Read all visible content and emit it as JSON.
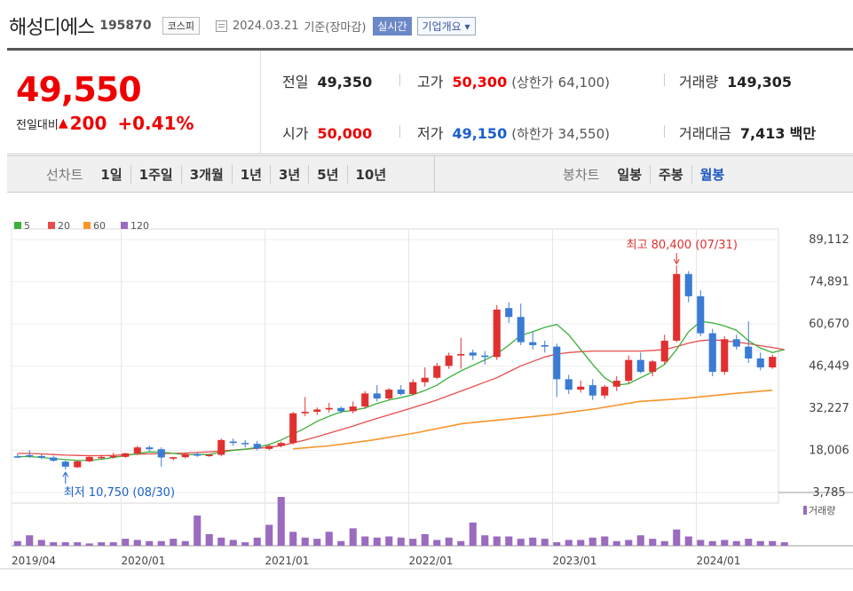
{
  "header": {
    "name": "해성디에스",
    "code": "195870",
    "market": "코스피",
    "date": "2024.03.21",
    "basis": "기준(장마감)",
    "realtime": "실시간",
    "overview": "기업개요"
  },
  "quote": {
    "price": "49,550",
    "diff_label": "전일대비",
    "diff_tri": "▲",
    "diff": "200",
    "rate": "+0.41%",
    "prev_label": "전일",
    "prev": "49,350",
    "high_label": "고가",
    "high": "50,300",
    "upper_label": "(상한가",
    "upper": "64,100)",
    "volume_label": "거래량",
    "volume": "149,305",
    "open_label": "시가",
    "open": "50,000",
    "low_label": "저가",
    "low": "49,150",
    "lower_label": "(하한가",
    "lower": "34,550)",
    "amount_label": "거래대금",
    "amount": "7,413",
    "amount_unit": "백만"
  },
  "tabs": {
    "line_label": "선차트",
    "line_periods": [
      "1일",
      "1주일",
      "3개월",
      "1년",
      "3년",
      "5년",
      "10년"
    ],
    "candle_label": "봉차트",
    "candle_periods": [
      "일봉",
      "주봉",
      "월봉"
    ],
    "active_candle": 2
  },
  "chart_data": {
    "type": "candlestick",
    "legend": [
      {
        "name": "5",
        "color": "#3cb03c"
      },
      {
        "name": "20",
        "color": "#e84c4c"
      },
      {
        "name": "60",
        "color": "#f7952b"
      },
      {
        "name": "120",
        "color": "#9a6bbf"
      }
    ],
    "yticks": [
      "89,112",
      "74,891",
      "60,670",
      "46,449",
      "32,227",
      "18,006",
      "3,785"
    ],
    "ylim": [
      3785,
      89112
    ],
    "xticks": [
      "2019/04",
      "2020/01",
      "2021/01",
      "2022/01",
      "2023/01",
      "2024/01"
    ],
    "max_annotation": "최고 80,400 (07/31)",
    "min_annotation": "최저 10,750 (08/30)",
    "volume_label": "거래량",
    "up_color": "#e03030",
    "down_color": "#3a7bd5",
    "candles": [
      {
        "o": 16000,
        "h": 16800,
        "l": 15500,
        "c": 15900
      },
      {
        "o": 16400,
        "h": 18100,
        "l": 15400,
        "c": 16100
      },
      {
        "o": 16100,
        "h": 16700,
        "l": 15000,
        "c": 15600
      },
      {
        "o": 15600,
        "h": 16200,
        "l": 14200,
        "c": 14500
      },
      {
        "o": 14200,
        "h": 14600,
        "l": 11500,
        "c": 12500
      },
      {
        "o": 12300,
        "h": 14500,
        "l": 12000,
        "c": 14300
      },
      {
        "o": 14300,
        "h": 16000,
        "l": 14000,
        "c": 15800
      },
      {
        "o": 15800,
        "h": 16500,
        "l": 15000,
        "c": 15800
      },
      {
        "o": 15800,
        "h": 17200,
        "l": 15200,
        "c": 16100
      },
      {
        "o": 15800,
        "h": 17200,
        "l": 15500,
        "c": 17000
      },
      {
        "o": 17000,
        "h": 19500,
        "l": 16500,
        "c": 19000
      },
      {
        "o": 19000,
        "h": 19700,
        "l": 17800,
        "c": 18400
      },
      {
        "o": 18400,
        "h": 19000,
        "l": 12500,
        "c": 15600
      },
      {
        "o": 15200,
        "h": 15800,
        "l": 14600,
        "c": 15700
      },
      {
        "o": 15700,
        "h": 17200,
        "l": 15300,
        "c": 16800
      },
      {
        "o": 16800,
        "h": 17300,
        "l": 15800,
        "c": 16200
      },
      {
        "o": 16200,
        "h": 16800,
        "l": 15800,
        "c": 16500
      },
      {
        "o": 16500,
        "h": 22000,
        "l": 16000,
        "c": 21500
      },
      {
        "o": 21000,
        "h": 22000,
        "l": 19500,
        "c": 20500
      },
      {
        "o": 20500,
        "h": 21500,
        "l": 19000,
        "c": 20200
      },
      {
        "o": 20200,
        "h": 21200,
        "l": 18000,
        "c": 18600
      },
      {
        "o": 18500,
        "h": 20000,
        "l": 18000,
        "c": 19500
      },
      {
        "o": 19500,
        "h": 21000,
        "l": 19000,
        "c": 20500
      },
      {
        "o": 20500,
        "h": 31000,
        "l": 20000,
        "c": 30500
      },
      {
        "o": 30500,
        "h": 36000,
        "l": 29500,
        "c": 31000
      },
      {
        "o": 31000,
        "h": 32500,
        "l": 30000,
        "c": 31800
      },
      {
        "o": 31800,
        "h": 34000,
        "l": 30800,
        "c": 32300
      },
      {
        "o": 32300,
        "h": 32800,
        "l": 30500,
        "c": 31200
      },
      {
        "o": 31200,
        "h": 34500,
        "l": 30500,
        "c": 32800
      },
      {
        "o": 32800,
        "h": 38000,
        "l": 32000,
        "c": 37200
      },
      {
        "o": 37200,
        "h": 40000,
        "l": 34500,
        "c": 35500
      },
      {
        "o": 35500,
        "h": 39000,
        "l": 35000,
        "c": 38500
      },
      {
        "o": 38500,
        "h": 40000,
        "l": 36500,
        "c": 37000
      },
      {
        "o": 37000,
        "h": 42000,
        "l": 36500,
        "c": 41000
      },
      {
        "o": 41000,
        "h": 46000,
        "l": 39500,
        "c": 42500
      },
      {
        "o": 42500,
        "h": 47500,
        "l": 42000,
        "c": 46500
      },
      {
        "o": 46500,
        "h": 51000,
        "l": 45500,
        "c": 50000
      },
      {
        "o": 50000,
        "h": 56000,
        "l": 45500,
        "c": 50500
      },
      {
        "o": 51000,
        "h": 52000,
        "l": 48500,
        "c": 50000
      },
      {
        "o": 50000,
        "h": 51500,
        "l": 47000,
        "c": 49500
      },
      {
        "o": 49500,
        "h": 67000,
        "l": 48500,
        "c": 65500
      },
      {
        "o": 66000,
        "h": 68000,
        "l": 61000,
        "c": 63000
      },
      {
        "o": 63000,
        "h": 67500,
        "l": 53500,
        "c": 54500
      },
      {
        "o": 54500,
        "h": 58000,
        "l": 52000,
        "c": 53500
      },
      {
        "o": 53500,
        "h": 55000,
        "l": 51000,
        "c": 53000
      },
      {
        "o": 53000,
        "h": 54000,
        "l": 36000,
        "c": 42000
      },
      {
        "o": 42000,
        "h": 43500,
        "l": 37000,
        "c": 38500
      },
      {
        "o": 38500,
        "h": 41500,
        "l": 37500,
        "c": 39500
      },
      {
        "o": 40000,
        "h": 42000,
        "l": 35000,
        "c": 36500
      },
      {
        "o": 36500,
        "h": 40000,
        "l": 35500,
        "c": 39500
      },
      {
        "o": 39500,
        "h": 43000,
        "l": 38000,
        "c": 41500
      },
      {
        "o": 41500,
        "h": 50000,
        "l": 40500,
        "c": 48500
      },
      {
        "o": 48500,
        "h": 51000,
        "l": 44000,
        "c": 44500
      },
      {
        "o": 44500,
        "h": 48500,
        "l": 43000,
        "c": 48000
      },
      {
        "o": 48000,
        "h": 57000,
        "l": 47000,
        "c": 55000
      },
      {
        "o": 55000,
        "h": 80400,
        "l": 54500,
        "c": 77500
      },
      {
        "o": 77500,
        "h": 78500,
        "l": 68000,
        "c": 70000
      },
      {
        "o": 70000,
        "h": 72000,
        "l": 56500,
        "c": 57500
      },
      {
        "o": 57500,
        "h": 59000,
        "l": 43000,
        "c": 44500
      },
      {
        "o": 44500,
        "h": 56500,
        "l": 43500,
        "c": 55500
      },
      {
        "o": 55500,
        "h": 57000,
        "l": 52000,
        "c": 53000
      },
      {
        "o": 53000,
        "h": 61500,
        "l": 47500,
        "c": 49000
      },
      {
        "o": 49000,
        "h": 51000,
        "l": 45000,
        "c": 46000
      },
      {
        "o": 46000,
        "h": 50300,
        "l": 45500,
        "c": 49550
      }
    ],
    "ma5": [
      15900,
      15900,
      15600,
      15200,
      14900,
      14600,
      14600,
      15000,
      15600,
      16200,
      16900,
      17500,
      17400,
      17000,
      16500,
      16600,
      16600,
      17400,
      18000,
      18400,
      19000,
      20000,
      21500,
      23500,
      25500,
      27800,
      29500,
      31000,
      31500,
      32300,
      33800,
      35000,
      35800,
      36800,
      38200,
      40000,
      42600,
      44800,
      46700,
      48500,
      50500,
      53500,
      56800,
      58000,
      59500,
      60500,
      57000,
      52000,
      47000,
      42500,
      40000,
      40500,
      42500,
      44500,
      47000,
      52000,
      58000,
      61500,
      61000,
      60000,
      58500,
      55000,
      52500,
      51000,
      52000
    ],
    "ma20": [
      17000,
      16950,
      16800,
      16600,
      16400,
      16300,
      16200,
      16200,
      16300,
      16500,
      16700,
      16800,
      16900,
      17000,
      17100,
      17300,
      17500,
      17800,
      18100,
      18400,
      18700,
      19000,
      19600,
      20500,
      21500,
      22600,
      23800,
      25000,
      26200,
      27500,
      28800,
      30000,
      31200,
      32400,
      33700,
      35000,
      36500,
      38000,
      39500,
      41000,
      42500,
      44500,
      46500,
      48000,
      49500,
      50500,
      51000,
      51300,
      51500,
      51500,
      51500,
      51500,
      51500,
      51700,
      52000,
      53000,
      54200,
      55000,
      55300,
      55000,
      54500,
      54000,
      53300,
      52700,
      52000
    ],
    "ma60": [
      null,
      null,
      null,
      null,
      null,
      null,
      null,
      null,
      null,
      null,
      null,
      null,
      null,
      null,
      null,
      null,
      null,
      null,
      null,
      null,
      null,
      null,
      null,
      null,
      null,
      null,
      null,
      null,
      null,
      null,
      null,
      null,
      null,
      null,
      null,
      null,
      null,
      null,
      null,
      null,
      null,
      null,
      null,
      null,
      null,
      null,
      null,
      null,
      null,
      null,
      null,
      null,
      null,
      null,
      null,
      null,
      null,
      null,
      null,
      null,
      null,
      null,
      null,
      null,
      null
    ],
    "ma60_path": [
      [
        26,
        18500
      ],
      [
        30,
        19500
      ],
      [
        35,
        21500
      ],
      [
        40,
        24000
      ],
      [
        45,
        27000
      ],
      [
        50,
        28500
      ],
      [
        55,
        30000
      ],
      [
        60,
        32000
      ],
      [
        65,
        34500
      ],
      [
        70,
        35500
      ],
      [
        75,
        37000
      ],
      [
        80,
        38300
      ]
    ],
    "volume": [
      4,
      9,
      5,
      3,
      3,
      3,
      2,
      3,
      3,
      6,
      5,
      4,
      4,
      6,
      4,
      26,
      10,
      7,
      5,
      3,
      7,
      18,
      42,
      12,
      7,
      6,
      12,
      4,
      15,
      8,
      7,
      8,
      7,
      6,
      10,
      5,
      7,
      4,
      20,
      9,
      8,
      8,
      6,
      7,
      6,
      3,
      5,
      5,
      7,
      8,
      4,
      5,
      9,
      6,
      4,
      14,
      8,
      5,
      4,
      5,
      4,
      6,
      4,
      4,
      3
    ]
  }
}
